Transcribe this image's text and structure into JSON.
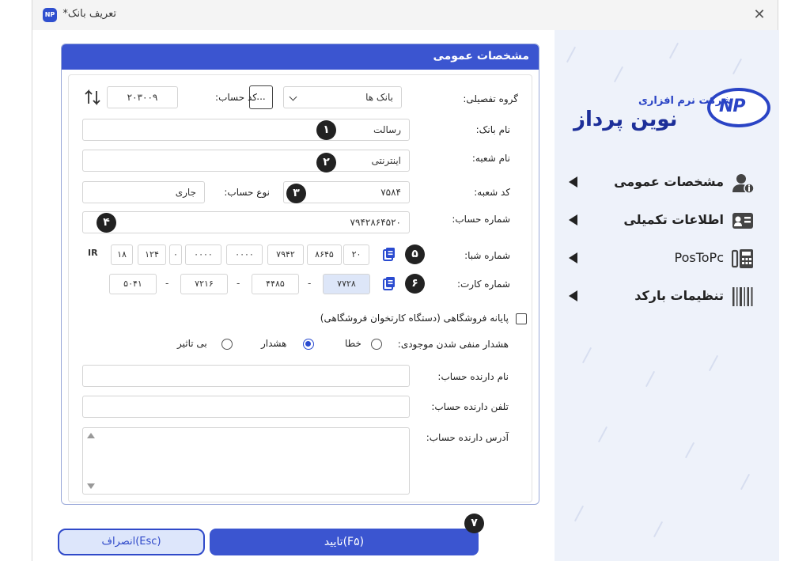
{
  "window": {
    "title": "تعریف بانک*",
    "app_icon": "NP",
    "close": "✕"
  },
  "panel": {
    "title": "مشخصات عمومی"
  },
  "form": {
    "group_label": "گروه تفصیلی:",
    "group_value": "بانک ها",
    "dots_label": "...",
    "account_code_label": "کد حساب:",
    "account_code_value": "۲۰۳۰۰۹",
    "bank_name_label": "نام بانک:",
    "bank_name_value": "رسالت",
    "branch_name_label": "نام شعبه:",
    "branch_name_value": "اینترنتی",
    "branch_code_label": "کد شعبه:",
    "branch_code_value": "۷۵۸۴",
    "account_type_label": "نوع حساب:",
    "account_type_value": "جاری",
    "account_number_label": "شماره حساب:",
    "account_number_value": "۷۹۴۲۸۶۴۵۲۰",
    "sheba_label": "شماره شبا:",
    "sheba_prefix": "IR",
    "sheba_segments": [
      "۱۸",
      "۱۲۴",
      "۰",
      "۰۰۰۰",
      "۰۰۰۰",
      "۷۹۴۲",
      "۸۶۴۵",
      "۲۰"
    ],
    "card_label": "شماره کارت:",
    "card_segments": [
      "۵۰۴۱",
      "۷۲۱۶",
      "۴۴۸۵",
      "۷۷۲۸"
    ],
    "card_sep": "-",
    "pos_label": "پایانه فروشگاهی (دستگاه کارتخوان فروشگاهی)",
    "negative_warning_label": "هشدار منفی شدن موجودی:",
    "radio_error": "خطا",
    "radio_warning": "هشدار",
    "radio_none": "بی تاثیر",
    "holder_name_label": "نام دارنده حساب:",
    "holder_phone_label": "تلفن دارنده حساب:",
    "holder_address_label": "آدرس دارنده حساب:"
  },
  "badges": [
    "۱",
    "۲",
    "۳",
    "۴",
    "۵",
    "۶",
    "۷"
  ],
  "sidebar": {
    "logo_top": "شرکت نرم افزاری",
    "logo_main": "نوین پرداز",
    "logo_mark": "NP",
    "items": [
      {
        "label": "مشخصات عمومی",
        "icon": "user-info-icon"
      },
      {
        "label": "اطلاعات تکمیلی",
        "icon": "id-card-icon"
      },
      {
        "label": "PosToPc",
        "icon": "pos-terminal-icon"
      },
      {
        "label": "تنظیمات بارکد",
        "icon": "barcode-icon"
      }
    ]
  },
  "buttons": {
    "ok": "تایید(F۵)",
    "cancel": "انصراف(Esc)"
  },
  "colors": {
    "accent": "#3b55d0",
    "sidebar_bg": "#eef2fa",
    "badge": "#222222"
  }
}
